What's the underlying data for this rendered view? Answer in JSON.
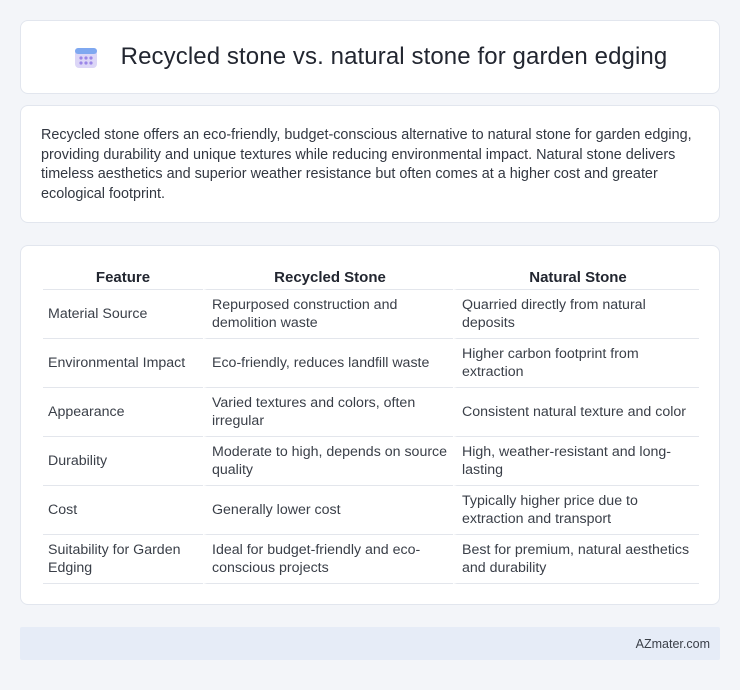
{
  "header": {
    "title": "Recycled stone vs. natural stone for garden edging",
    "icon": "calendar-icon"
  },
  "summary": {
    "text": "Recycled stone offers an eco-friendly, budget-conscious alternative to natural stone for garden edging, providing durability and unique textures while reducing environmental impact. Natural stone delivers timeless aesthetics and superior weather resistance but often comes at a higher cost and greater ecological footprint."
  },
  "table": {
    "headers": [
      "Feature",
      "Recycled Stone",
      "Natural Stone"
    ],
    "rows": [
      [
        "Material Source",
        "Repurposed construction and demolition waste",
        "Quarried directly from natural deposits"
      ],
      [
        "Environmental Impact",
        "Eco-friendly, reduces landfill waste",
        "Higher carbon footprint from extraction"
      ],
      [
        "Appearance",
        "Varied textures and colors, often irregular",
        "Consistent natural texture and color"
      ],
      [
        "Durability",
        "Moderate to high, depends on source quality",
        "High, weather-resistant and long-lasting"
      ],
      [
        "Cost",
        "Generally lower cost",
        "Typically higher price due to extraction and transport"
      ],
      [
        "Suitability for Garden Edging",
        "Ideal for budget-friendly and eco-conscious projects",
        "Best for premium, natural aesthetics and durability"
      ]
    ]
  },
  "footer": {
    "brand": "AZmater.com"
  }
}
